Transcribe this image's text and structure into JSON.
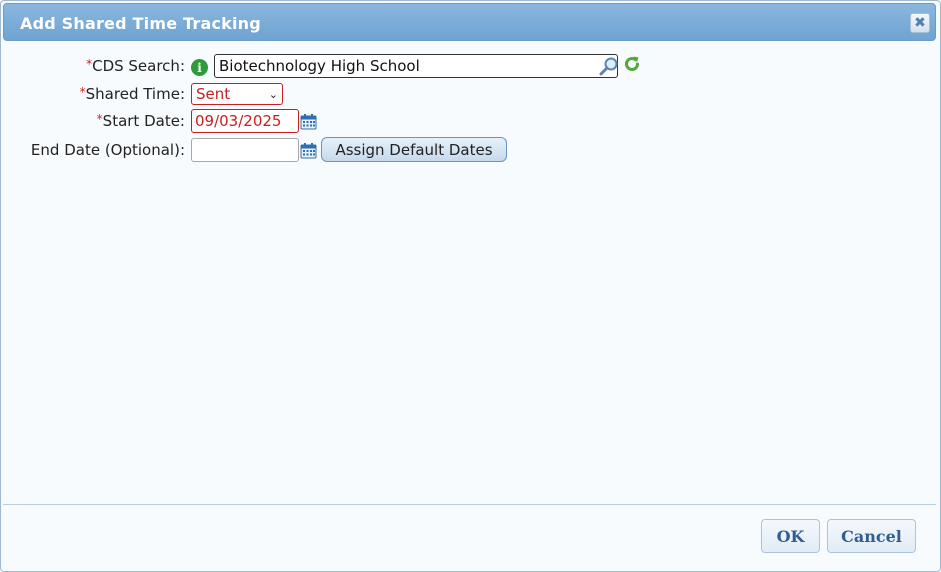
{
  "dialog": {
    "title": "Add Shared Time Tracking",
    "close_glyph": "✖"
  },
  "form": {
    "cds_search": {
      "required_mark": "*",
      "label": "CDS Search:",
      "value": "Biotechnology High School",
      "info_icon": "info-icon",
      "search_icon": "magnifier-icon",
      "refresh_icon": "refresh-icon"
    },
    "shared_time": {
      "required_mark": "*",
      "label": "Shared Time:",
      "selected": "Sent",
      "chevron": "⌄"
    },
    "start_date": {
      "required_mark": "*",
      "label": "Start Date:",
      "value": "09/03/2025",
      "calendar_icon": "calendar-icon"
    },
    "end_date": {
      "label": "End Date (Optional):",
      "value": "",
      "calendar_icon": "calendar-icon",
      "assign_button": "Assign Default Dates"
    }
  },
  "footer": {
    "ok_label": "OK",
    "cancel_label": "Cancel"
  },
  "colors": {
    "titlebar": "#7aaed9",
    "required": "#d21f1f",
    "button_text": "#2f5f90"
  }
}
